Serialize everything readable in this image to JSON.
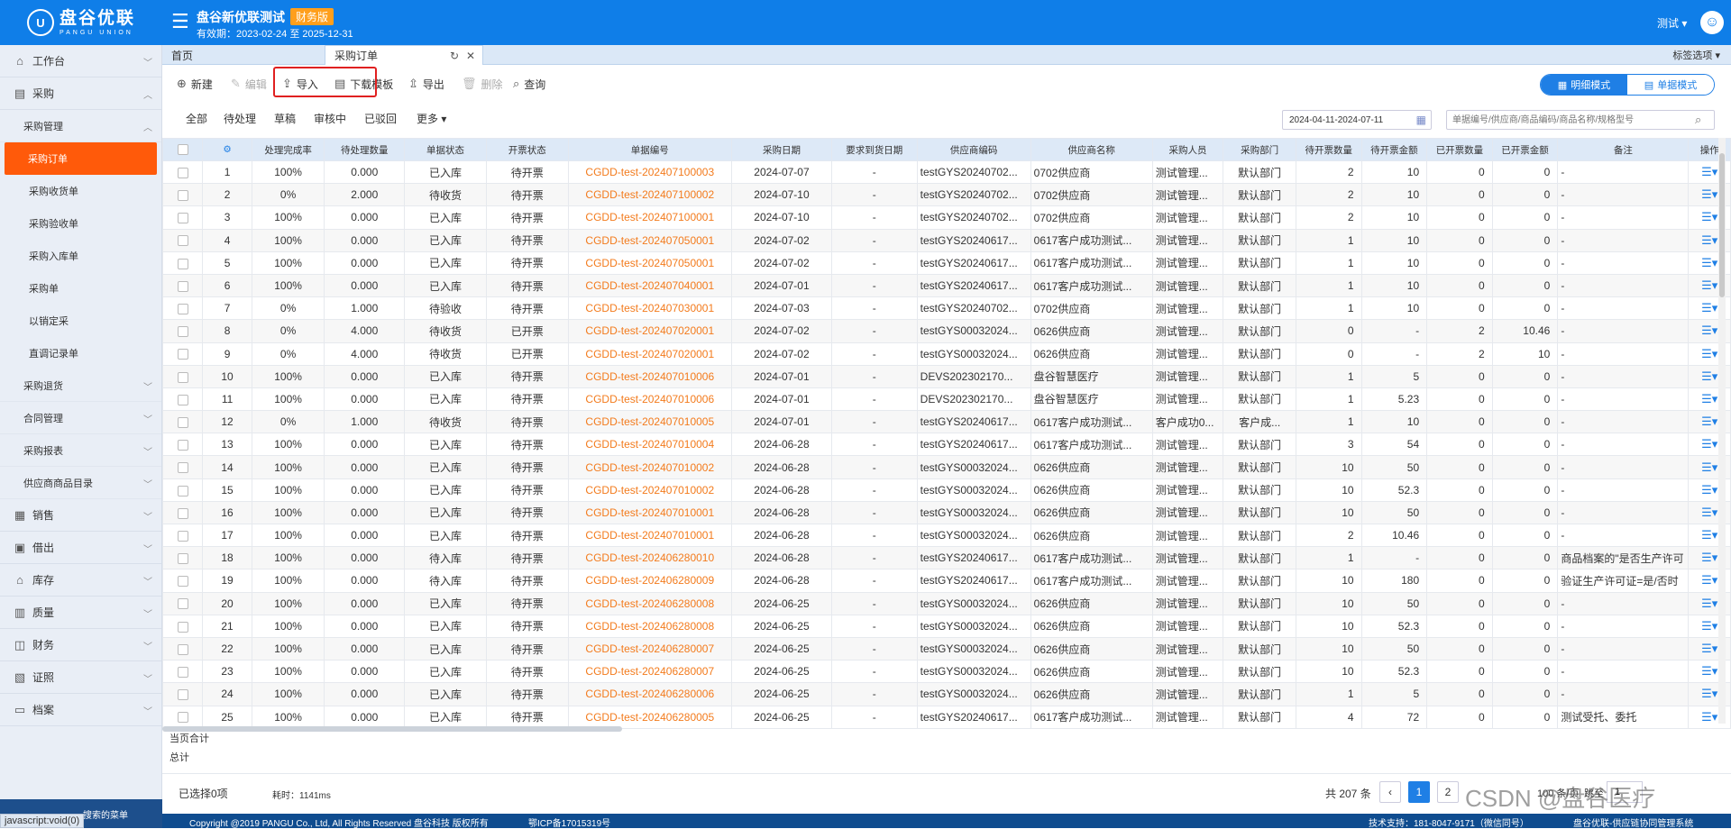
{
  "header": {
    "logo_text": "盘谷优联",
    "logo_sub": "PANGU UNION",
    "logo_mark": "U",
    "company": "盘谷新优联测试",
    "badge": "财务版",
    "validity": "有效期：2023-02-24 至 2025-12-31",
    "user": "测试 ▾"
  },
  "sidebar": {
    "workbench": "工作台",
    "purchase": "采购",
    "purchase_mgmt": "采购管理",
    "leaves": [
      "采购订单",
      "采购收货单",
      "采购验收单",
      "采购入库单",
      "采购单",
      "以销定采",
      "直调记录单"
    ],
    "subs": [
      "采购退货",
      "合同管理",
      "采购报表",
      "供应商商品目录"
    ],
    "modules": [
      "销售",
      "借出",
      "库存",
      "质量",
      "财务",
      "证照",
      "档案"
    ],
    "bottom": "搜索的菜单",
    "status_tip": "javascript:void(0)"
  },
  "tabs": {
    "home": "首页",
    "current": "采购订单",
    "selector": "标签选项 ▾"
  },
  "toolbar": {
    "new": "新建",
    "edit": "编辑",
    "import": "导入",
    "download": "下载模板",
    "export": "导出",
    "delete": "删除",
    "query": "查询"
  },
  "modes": {
    "detail": "明细模式",
    "doc": "单据模式"
  },
  "filters": {
    "all": "全部",
    "pending": "待处理",
    "draft": "草稿",
    "review": "审核中",
    "rejected": "已驳回",
    "more": "更多 ▾"
  },
  "date_range": "2024-04-11-2024-07-11",
  "search": {
    "placeholder": "单据编号/供应商/商品编码/商品名称/规格型号"
  },
  "columns": [
    "处理完成率",
    "待处理数量",
    "单据状态",
    "开票状态",
    "单据编号",
    "采购日期",
    "要求到货日期",
    "供应商编码",
    "供应商名称",
    "采购人员",
    "采购部门",
    "待开票数量",
    "待开票金额",
    "已开票数量",
    "已开票金额",
    "备注",
    "操作"
  ],
  "rows": [
    [
      "1",
      "100%",
      "0.000",
      "已入库",
      "待开票",
      "CGDD-test-202407100003",
      "2024-07-07",
      "-",
      "testGYS20240702...",
      "0702供应商",
      "测试管理...",
      "默认部门",
      "2",
      "10",
      "0",
      "0",
      "-"
    ],
    [
      "2",
      "0%",
      "2.000",
      "待收货",
      "待开票",
      "CGDD-test-202407100002",
      "2024-07-10",
      "-",
      "testGYS20240702...",
      "0702供应商",
      "测试管理...",
      "默认部门",
      "2",
      "10",
      "0",
      "0",
      "-"
    ],
    [
      "3",
      "100%",
      "0.000",
      "已入库",
      "待开票",
      "CGDD-test-202407100001",
      "2024-07-10",
      "-",
      "testGYS20240702...",
      "0702供应商",
      "测试管理...",
      "默认部门",
      "2",
      "10",
      "0",
      "0",
      "-"
    ],
    [
      "4",
      "100%",
      "0.000",
      "已入库",
      "待开票",
      "CGDD-test-202407050001",
      "2024-07-02",
      "-",
      "testGYS20240617...",
      "0617客户成功测试...",
      "测试管理...",
      "默认部门",
      "1",
      "10",
      "0",
      "0",
      "-"
    ],
    [
      "5",
      "100%",
      "0.000",
      "已入库",
      "待开票",
      "CGDD-test-202407050001",
      "2024-07-02",
      "-",
      "testGYS20240617...",
      "0617客户成功测试...",
      "测试管理...",
      "默认部门",
      "1",
      "10",
      "0",
      "0",
      "-"
    ],
    [
      "6",
      "100%",
      "0.000",
      "已入库",
      "待开票",
      "CGDD-test-202407040001",
      "2024-07-01",
      "-",
      "testGYS20240617...",
      "0617客户成功测试...",
      "测试管理...",
      "默认部门",
      "1",
      "10",
      "0",
      "0",
      "-"
    ],
    [
      "7",
      "0%",
      "1.000",
      "待验收",
      "待开票",
      "CGDD-test-202407030001",
      "2024-07-03",
      "-",
      "testGYS20240702...",
      "0702供应商",
      "测试管理...",
      "默认部门",
      "1",
      "10",
      "0",
      "0",
      "-"
    ],
    [
      "8",
      "0%",
      "4.000",
      "待收货",
      "已开票",
      "CGDD-test-202407020001",
      "2024-07-02",
      "-",
      "testGYS00032024...",
      "0626供应商",
      "测试管理...",
      "默认部门",
      "0",
      "-",
      "2",
      "10.46",
      "-"
    ],
    [
      "9",
      "0%",
      "4.000",
      "待收货",
      "已开票",
      "CGDD-test-202407020001",
      "2024-07-02",
      "-",
      "testGYS00032024...",
      "0626供应商",
      "测试管理...",
      "默认部门",
      "0",
      "-",
      "2",
      "10",
      "-"
    ],
    [
      "10",
      "100%",
      "0.000",
      "已入库",
      "待开票",
      "CGDD-test-202407010006",
      "2024-07-01",
      "-",
      "DEVS202302170...",
      "盘谷智慧医疗",
      "测试管理...",
      "默认部门",
      "1",
      "5",
      "0",
      "0",
      "-"
    ],
    [
      "11",
      "100%",
      "0.000",
      "已入库",
      "待开票",
      "CGDD-test-202407010006",
      "2024-07-01",
      "-",
      "DEVS202302170...",
      "盘谷智慧医疗",
      "测试管理...",
      "默认部门",
      "1",
      "5.23",
      "0",
      "0",
      "-"
    ],
    [
      "12",
      "0%",
      "1.000",
      "待收货",
      "待开票",
      "CGDD-test-202407010005",
      "2024-07-01",
      "-",
      "testGYS20240617...",
      "0617客户成功测试...",
      "客户成功0...",
      "客户成...",
      "1",
      "10",
      "0",
      "0",
      "-"
    ],
    [
      "13",
      "100%",
      "0.000",
      "已入库",
      "待开票",
      "CGDD-test-202407010004",
      "2024-06-28",
      "-",
      "testGYS20240617...",
      "0617客户成功测试...",
      "测试管理...",
      "默认部门",
      "3",
      "54",
      "0",
      "0",
      "-"
    ],
    [
      "14",
      "100%",
      "0.000",
      "已入库",
      "待开票",
      "CGDD-test-202407010002",
      "2024-06-28",
      "-",
      "testGYS00032024...",
      "0626供应商",
      "测试管理...",
      "默认部门",
      "10",
      "50",
      "0",
      "0",
      "-"
    ],
    [
      "15",
      "100%",
      "0.000",
      "已入库",
      "待开票",
      "CGDD-test-202407010002",
      "2024-06-28",
      "-",
      "testGYS00032024...",
      "0626供应商",
      "测试管理...",
      "默认部门",
      "10",
      "52.3",
      "0",
      "0",
      "-"
    ],
    [
      "16",
      "100%",
      "0.000",
      "已入库",
      "待开票",
      "CGDD-test-202407010001",
      "2024-06-28",
      "-",
      "testGYS00032024...",
      "0626供应商",
      "测试管理...",
      "默认部门",
      "10",
      "50",
      "0",
      "0",
      "-"
    ],
    [
      "17",
      "100%",
      "0.000",
      "已入库",
      "待开票",
      "CGDD-test-202407010001",
      "2024-06-28",
      "-",
      "testGYS00032024...",
      "0626供应商",
      "测试管理...",
      "默认部门",
      "2",
      "10.46",
      "0",
      "0",
      "-"
    ],
    [
      "18",
      "100%",
      "0.000",
      "待入库",
      "待开票",
      "CGDD-test-202406280010",
      "2024-06-28",
      "-",
      "testGYS20240617...",
      "0617客户成功测试...",
      "测试管理...",
      "默认部门",
      "1",
      "-",
      "0",
      "0",
      "商品档案的\"是否生产许可"
    ],
    [
      "19",
      "100%",
      "0.000",
      "待入库",
      "待开票",
      "CGDD-test-202406280009",
      "2024-06-28",
      "-",
      "testGYS20240617...",
      "0617客户成功测试...",
      "测试管理...",
      "默认部门",
      "10",
      "180",
      "0",
      "0",
      "验证生产许可证=是/否时"
    ],
    [
      "20",
      "100%",
      "0.000",
      "已入库",
      "待开票",
      "CGDD-test-202406280008",
      "2024-06-25",
      "-",
      "testGYS00032024...",
      "0626供应商",
      "测试管理...",
      "默认部门",
      "10",
      "50",
      "0",
      "0",
      "-"
    ],
    [
      "21",
      "100%",
      "0.000",
      "已入库",
      "待开票",
      "CGDD-test-202406280008",
      "2024-06-25",
      "-",
      "testGYS00032024...",
      "0626供应商",
      "测试管理...",
      "默认部门",
      "10",
      "52.3",
      "0",
      "0",
      "-"
    ],
    [
      "22",
      "100%",
      "0.000",
      "已入库",
      "待开票",
      "CGDD-test-202406280007",
      "2024-06-25",
      "-",
      "testGYS00032024...",
      "0626供应商",
      "测试管理...",
      "默认部门",
      "10",
      "50",
      "0",
      "0",
      "-"
    ],
    [
      "23",
      "100%",
      "0.000",
      "已入库",
      "待开票",
      "CGDD-test-202406280007",
      "2024-06-25",
      "-",
      "testGYS00032024...",
      "0626供应商",
      "测试管理...",
      "默认部门",
      "10",
      "52.3",
      "0",
      "0",
      "-"
    ],
    [
      "24",
      "100%",
      "0.000",
      "已入库",
      "待开票",
      "CGDD-test-202406280006",
      "2024-06-25",
      "-",
      "testGYS00032024...",
      "0626供应商",
      "测试管理...",
      "默认部门",
      "1",
      "5",
      "0",
      "0",
      "-"
    ],
    [
      "25",
      "100%",
      "0.000",
      "已入库",
      "待开票",
      "CGDD-test-202406280005",
      "2024-06-25",
      "-",
      "testGYS20240617...",
      "0617客户成功测试...",
      "测试管理...",
      "默认部门",
      "4",
      "72",
      "0",
      "0",
      "测试受托、委托"
    ]
  ],
  "totals": {
    "page": "当页合计",
    "all": "总计"
  },
  "footer": {
    "selected": "已选择0项",
    "elapsed": "耗时：1141ms",
    "total": "共 207 条",
    "pages": [
      "1",
      "2"
    ],
    "page_size": "100 条/页",
    "goto": "跳至",
    "goto_value": "1",
    "prev": "‹"
  },
  "copyright": {
    "left": "Copyright @2019 PANGU Co., Ltd, All Rights Reserved 盘谷科技 版权所有",
    "icp": "鄂ICP备17015319号",
    "support": "技术支持：181-8047-9171（微信同号）",
    "brand": "盘谷优联-供应链协同管理系统"
  },
  "watermark": "CSDN @盘谷医疗",
  "colors": {
    "primary": "#0f7ee8",
    "active_menu": "#ff5a0a",
    "link_orange": "#f37b1d",
    "highlight_box": "#e02020"
  },
  "icons": {
    "menu": "menu-icon",
    "refresh": "refresh-icon",
    "close": "close-icon",
    "settings": "gear-icon",
    "calendar": "calendar-icon",
    "search": "search-icon",
    "operation": "list-menu-icon"
  }
}
